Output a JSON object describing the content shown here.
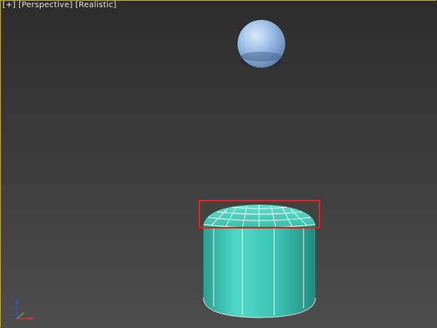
{
  "viewport": {
    "labels": {
      "plus_menu": "[+]",
      "view_menu": "[Perspective]",
      "shading_menu": "[Realistic]"
    },
    "colors": {
      "sphere": "#8fb3df",
      "cylinder": "#3fc9b8",
      "cylinder_dark": "#2aa596",
      "wireframe": "#ffffff",
      "selection": "#e02020",
      "axis_x": "#e03030",
      "axis_y": "#30c030",
      "axis_z": "#3050e0"
    }
  },
  "scene": {
    "objects": [
      {
        "name": "sphere",
        "type": "sphere"
      },
      {
        "name": "cylinder",
        "type": "cylinder"
      }
    ],
    "selection_box": true
  },
  "axis_tripod": {
    "icon": "axis-tripod-icon"
  }
}
